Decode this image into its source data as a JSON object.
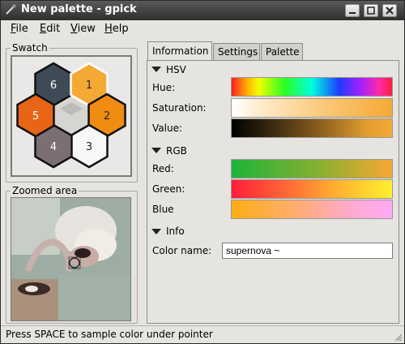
{
  "window": {
    "title": "New palette - gpick",
    "buttons": [
      "minimize",
      "maximize",
      "close"
    ]
  },
  "menu": {
    "items": [
      {
        "label": "File",
        "mnemonic": "F"
      },
      {
        "label": "Edit",
        "mnemonic": "E"
      },
      {
        "label": "View",
        "mnemonic": "V"
      },
      {
        "label": "Help",
        "mnemonic": "H"
      }
    ]
  },
  "swatch": {
    "label": "Swatch",
    "cells": [
      {
        "number": "6",
        "color": "#3f4a57"
      },
      {
        "number": "1",
        "color": "#f5a935"
      },
      {
        "number": "2",
        "color": "#f08c12"
      },
      {
        "number": "3",
        "color": "#f7f7f5"
      },
      {
        "number": "4",
        "color": "#7b6e75"
      },
      {
        "number": "5",
        "color": "#e86417"
      }
    ],
    "center_color": "#d4d3cf"
  },
  "zoomed": {
    "label": "Zoomed area"
  },
  "tabs": [
    {
      "label": "Information",
      "active": true
    },
    {
      "label": "Settings",
      "active": false
    },
    {
      "label": "Palette",
      "active": false
    }
  ],
  "info": {
    "hsv_label": "HSV",
    "rgb_label": "RGB",
    "info_label": "Info",
    "hue_label": "Hue:",
    "saturation_label": "Saturation:",
    "value_label": "Value:",
    "red_label": "Red:",
    "green_label": "Green:",
    "blue_label": "Blue",
    "color_name_label": "Color name:",
    "color_name_value": "supernova ~"
  },
  "status": {
    "text": "Press SPACE to sample color under pointer"
  },
  "accent_colors": {
    "titlebar": "#3a3a3a",
    "selected_color": "#f5a935"
  }
}
